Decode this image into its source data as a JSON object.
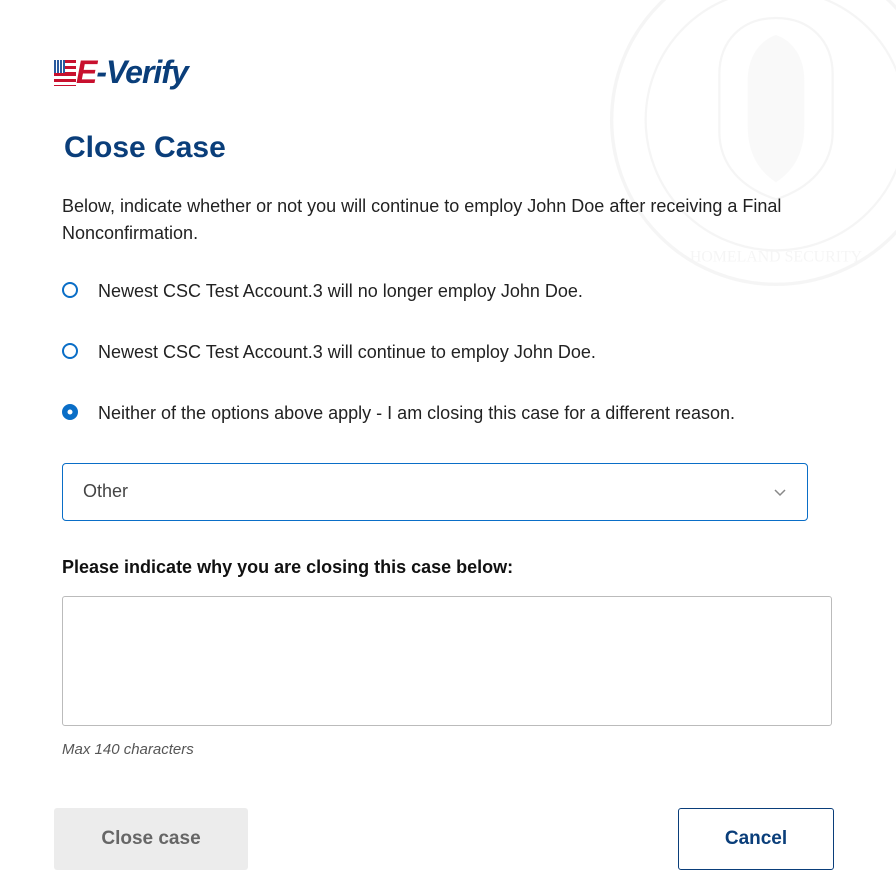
{
  "logo": {
    "e": "E",
    "dash": "-",
    "verify": "Verify"
  },
  "page_title": "Close Case",
  "instruction": "Below, indicate whether or not you will continue to employ John Doe after receiving a Final Nonconfirmation.",
  "radio_options": [
    {
      "label": "Newest CSC Test Account.3 will no longer employ John Doe.",
      "selected": false
    },
    {
      "label": "Newest CSC Test Account.3 will continue to employ John Doe.",
      "selected": false
    },
    {
      "label": "Neither of the options above apply - I am closing this case for a different reason.",
      "selected": true
    }
  ],
  "dropdown": {
    "selected": "Other"
  },
  "textarea": {
    "label": "Please indicate why you are closing this case below:",
    "value": "",
    "hint": "Max 140 characters"
  },
  "buttons": {
    "close_case": "Close case",
    "cancel": "Cancel"
  }
}
